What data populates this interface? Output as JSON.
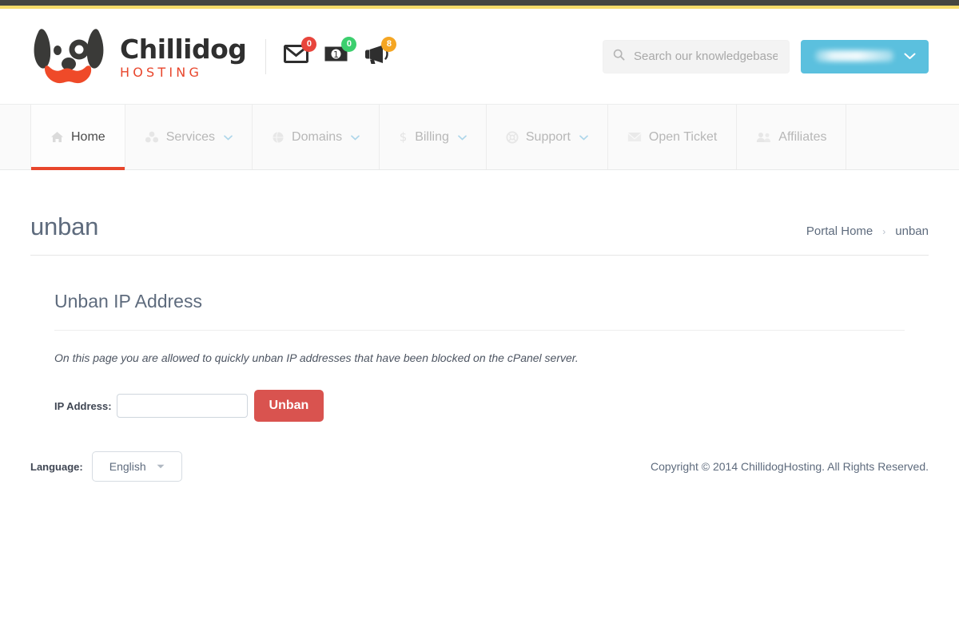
{
  "brand": {
    "name": "Chillidog",
    "subtitle": "HOSTING",
    "logo_icon": "dog-face-logo"
  },
  "header": {
    "notifications": [
      {
        "icon": "envelope-icon",
        "name": "messages",
        "count": "0",
        "color": "#e8453c"
      },
      {
        "icon": "invoice-icon",
        "name": "invoices",
        "count": "0",
        "color": "#3ccf6e"
      },
      {
        "icon": "megaphone-icon",
        "name": "announcements",
        "count": "8",
        "color": "#f5a623"
      }
    ],
    "search": {
      "placeholder": "Search our knowledgebase",
      "value": "",
      "icon": "search-icon"
    },
    "account": {
      "label": "",
      "redacted": true,
      "caret_icon": "chevron-down-icon",
      "color": "#5bc0de"
    }
  },
  "nav": {
    "active_index": 0,
    "accent_color": "#e8462c",
    "items": [
      {
        "label": "Home",
        "icon": "home-icon",
        "caret": false
      },
      {
        "label": "Services",
        "icon": "cubes-icon",
        "caret": true
      },
      {
        "label": "Domains",
        "icon": "globe-icon",
        "caret": true
      },
      {
        "label": "Billing",
        "icon": "dollar-icon",
        "caret": true
      },
      {
        "label": "Support",
        "icon": "lifering-icon",
        "caret": true
      },
      {
        "label": "Open Ticket",
        "icon": "envelope-icon",
        "caret": false
      },
      {
        "label": "Affiliates",
        "icon": "users-icon",
        "caret": false
      }
    ]
  },
  "page": {
    "title": "unban",
    "breadcrumb": {
      "home_label": "Portal Home",
      "separator": "›",
      "current_label": "unban"
    }
  },
  "panel": {
    "title": "Unban IP Address",
    "description": "On this page you are allowed to quickly unban IP addresses that have been blocked on the cPanel server.",
    "form": {
      "ip_label": "IP Address:",
      "ip_value": "",
      "ip_placeholder": "",
      "submit_label": "Unban",
      "submit_color": "#d9534f"
    }
  },
  "footer": {
    "language_label": "Language:",
    "language_value": "English",
    "language_caret_icon": "caret-down-icon",
    "copyright": "Copyright © 2014 ChillidogHosting. All Rights Reserved."
  }
}
